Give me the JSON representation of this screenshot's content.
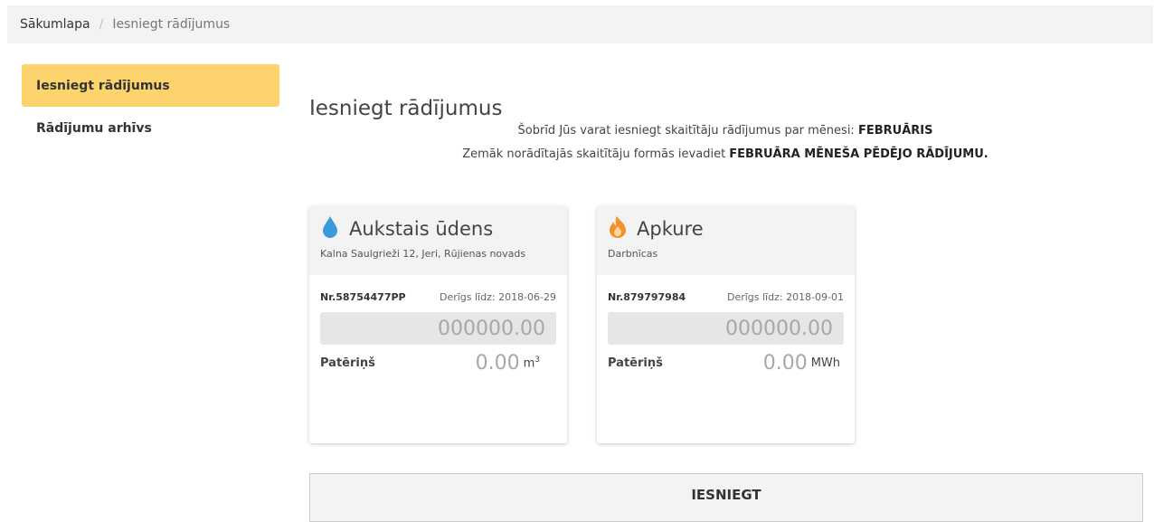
{
  "breadcrumb": {
    "home": "Sākumlapa",
    "separator": "/",
    "current": "Iesniegt rādījumus"
  },
  "sidebar": {
    "items": [
      {
        "label": "Iesniegt rādījumus",
        "active": true
      },
      {
        "label": "Rādījumu arhīvs",
        "active": false
      }
    ]
  },
  "main": {
    "title": "Iesniegt rādījumus",
    "notice_line1_text": "Šobrīd Jūs varat iesniegt skaitītāju rādījumus par mēnesi: ",
    "notice_line1_bold": "FEBRUĀRIS",
    "notice_line2_text": "Zemāk norādītajās skaitītāju formās ievadiet ",
    "notice_line2_bold": "FEBRUĀRA MĒNEŠA PĒDĒJO RĀDĪJUMU."
  },
  "meters": [
    {
      "icon": "water-drop-icon",
      "icon_color": "#3a9ad9",
      "title": "Aukstais ūdens",
      "subtitle": "Kalna Saulgrieži 12, Jeri, Rūjienas novads",
      "number": "Nr.58754477PP",
      "valid_until": "Derīgs līdz: 2018-06-29",
      "reading_placeholder": "000000.00",
      "usage_label": "Patēriņš",
      "usage_value": "0.00",
      "usage_unit": "m",
      "usage_unit_sup": "3"
    },
    {
      "icon": "flame-icon",
      "icon_color": "#f0932b",
      "title": "Apkure",
      "subtitle": "Darbnīcas",
      "number": "Nr.879797984",
      "valid_until": "Derīgs līdz: 2018-09-01",
      "reading_placeholder": "000000.00",
      "usage_label": "Patēriņš",
      "usage_value": "0.00",
      "usage_unit": "MWh"
    }
  ],
  "actions": {
    "submit_label": "IESNIEGT"
  },
  "colors": {
    "accent": "#fdd36e",
    "panel": "#f3f3f3",
    "input_bg": "#e6e6e6"
  }
}
